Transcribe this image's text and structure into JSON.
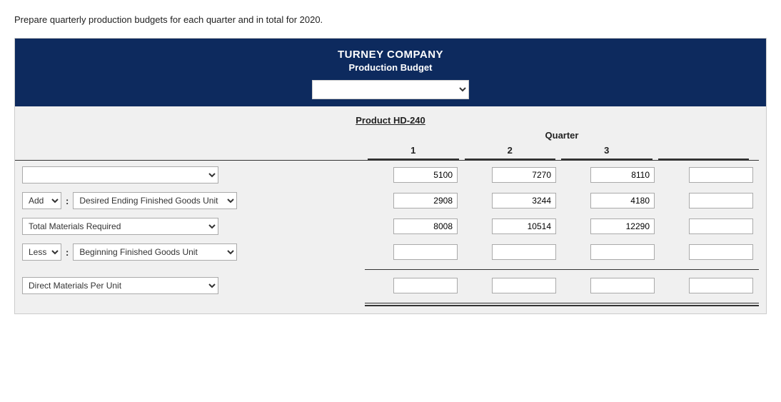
{
  "intro": {
    "text": "Prepare quarterly production budgets for each quarter and in total for 2020."
  },
  "header": {
    "company": "TURNEY COMPANY",
    "title": "Production Budget",
    "dropdown_placeholder": ""
  },
  "table": {
    "product_label": "Product HD-240",
    "quarter_label": "Quarter",
    "columns": [
      "1",
      "2",
      "3",
      ""
    ],
    "rows": [
      {
        "id": "row1",
        "label_type": "full_select",
        "full_select_value": "",
        "prefix": "",
        "colon": false,
        "values": [
          "5100",
          "7270",
          "8110",
          ""
        ]
      },
      {
        "id": "row2",
        "label_type": "prefix_main",
        "prefix_value": "Add",
        "main_value": "Desired Ending Finished Goods Unit",
        "colon": true,
        "values": [
          "2908",
          "3244",
          "4180",
          ""
        ]
      },
      {
        "id": "row3",
        "label_type": "full_select",
        "full_select_value": "Total Materials Required",
        "prefix": "",
        "colon": false,
        "values": [
          "8008",
          "10514",
          "12290",
          ""
        ]
      },
      {
        "id": "row4",
        "label_type": "prefix_main",
        "prefix_value": "Less",
        "main_value": "Beginning Finished Goods Unit",
        "colon": true,
        "values": [
          "",
          "",
          "",
          ""
        ]
      },
      {
        "id": "row5",
        "label_type": "full_select",
        "full_select_value": "Direct Materials Per Unit",
        "prefix": "",
        "colon": false,
        "values": [
          "",
          "",
          "",
          ""
        ]
      }
    ],
    "prefix_options": [
      "Add",
      "Less"
    ],
    "main_options_desired": [
      "Desired Ending Finished Goods Unit"
    ],
    "main_options_beginning": [
      "Beginning Finished Goods Unit"
    ],
    "full_options_row1": [
      ""
    ],
    "full_options_row3": [
      "Total Materials Required"
    ],
    "full_options_row5": [
      "Direct Materials Per Unit"
    ]
  }
}
